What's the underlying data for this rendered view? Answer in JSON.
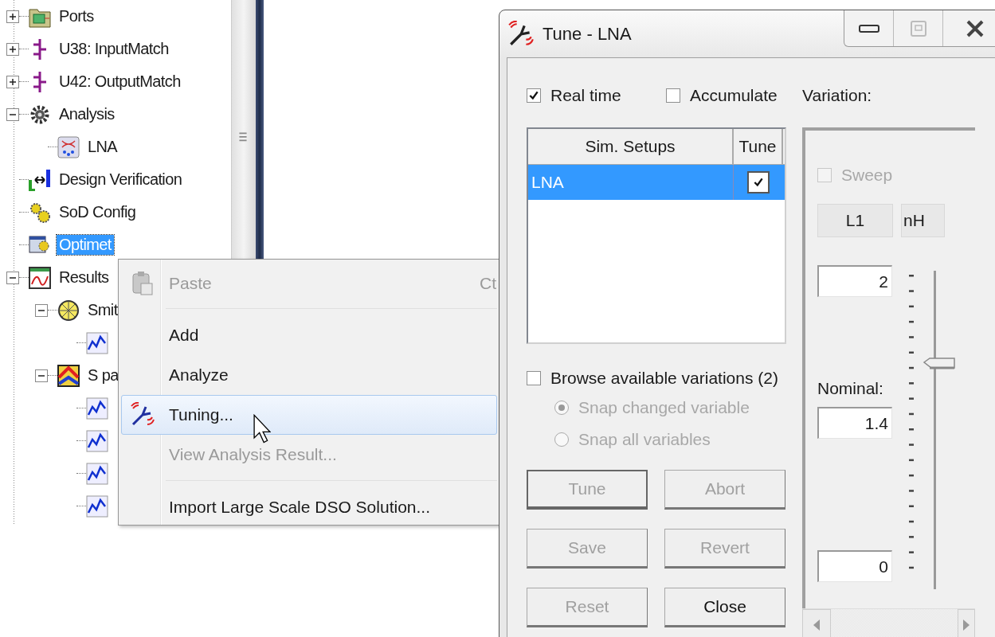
{
  "tree": [
    {
      "label": "Ports",
      "kind": "ports",
      "expanded": false,
      "selected": false
    },
    {
      "label": "U38: InputMatch",
      "kind": "subcircuit",
      "expanded": false,
      "selected": false
    },
    {
      "label": "U42: OutputMatch",
      "kind": "subcircuit",
      "expanded": false,
      "selected": false
    },
    {
      "label": "Analysis",
      "kind": "analysis",
      "expanded": true,
      "selected": false,
      "children": [
        {
          "label": "LNA",
          "kind": "setup",
          "selected": false
        }
      ]
    },
    {
      "label": "Design Verification",
      "kind": "verification",
      "selected": false
    },
    {
      "label": "SoD Config",
      "kind": "config",
      "selected": false
    },
    {
      "label": "Optimet",
      "kind": "optimetrics",
      "selected": true
    },
    {
      "label": "Results",
      "kind": "results",
      "expanded": true,
      "selected": false,
      "children": [
        {
          "label": "Smit",
          "kind": "smith",
          "expanded": true,
          "selected": false,
          "children": [
            {
              "kind": "trace",
              "selected": false
            }
          ]
        },
        {
          "label": "S pa",
          "kind": "sparam",
          "expanded": true,
          "selected": false,
          "children": [
            {
              "kind": "trace",
              "selected": false
            },
            {
              "kind": "trace",
              "selected": false
            },
            {
              "kind": "trace",
              "selected": false
            },
            {
              "kind": "trace",
              "selected": false
            }
          ]
        }
      ]
    }
  ],
  "context_menu": [
    {
      "kind": "paste",
      "label": "Paste",
      "shortcut": "Ct",
      "disabled": true,
      "highlighted": false
    },
    {
      "kind": "separator"
    },
    {
      "kind": "command",
      "label": "Add",
      "disabled": false,
      "highlighted": false
    },
    {
      "kind": "command",
      "label": "Analyze",
      "disabled": false,
      "highlighted": false
    },
    {
      "kind": "tuning",
      "label": "Tuning...",
      "disabled": false,
      "highlighted": true
    },
    {
      "kind": "command",
      "label": "View Analysis Result...",
      "disabled": true,
      "highlighted": false
    },
    {
      "kind": "separator"
    },
    {
      "kind": "command",
      "label": "Import Large Scale DSO Solution...",
      "disabled": false,
      "highlighted": false
    }
  ],
  "dialog": {
    "title": "Tune - LNA",
    "maximize_disabled": true,
    "real_time": {
      "label": "Real time",
      "checked": true
    },
    "accumulate": {
      "label": "Accumulate",
      "checked": false
    },
    "variation_label": "Variation:",
    "table": {
      "columns": [
        "Sim. Setups",
        "Tune"
      ],
      "rows": [
        {
          "setup": "LNA",
          "tune": true,
          "selected": true
        }
      ]
    },
    "browse": {
      "label": "Browse available variations (2)",
      "checked": false
    },
    "snap_options": [
      {
        "label": "Snap changed variable",
        "selected": true,
        "disabled": true
      },
      {
        "label": "Snap all variables",
        "selected": false,
        "disabled": true
      }
    ],
    "buttons": [
      {
        "label": "Tune",
        "disabled": true,
        "default": true
      },
      {
        "label": "Abort",
        "disabled": true,
        "default": false
      },
      {
        "label": "Save",
        "disabled": true,
        "default": false
      },
      {
        "label": "Revert",
        "disabled": true,
        "default": false
      },
      {
        "label": "Reset",
        "disabled": true,
        "default": false
      },
      {
        "label": "Close",
        "disabled": false,
        "default": false
      }
    ],
    "variation": {
      "sweep": {
        "label": "Sweep",
        "checked": false,
        "disabled": true
      },
      "variable": "L1",
      "unit": "nH",
      "max": "2",
      "nominal_label": "Nominal:",
      "nominal": "1.4",
      "min": "0",
      "slider": {
        "level": 0.7
      }
    }
  }
}
